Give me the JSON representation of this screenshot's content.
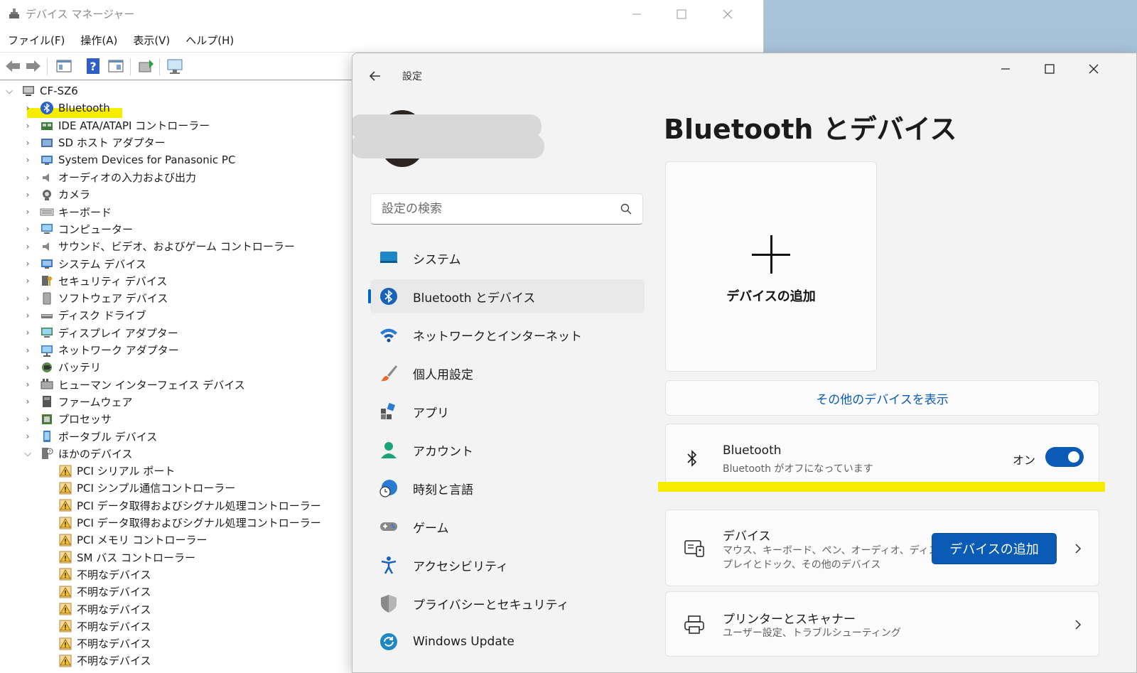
{
  "device_manager": {
    "title": "デバイス マネージャー",
    "menu": [
      "ファイル(F)",
      "操作(A)",
      "表示(V)",
      "ヘルプ(H)"
    ],
    "root": "CF-SZ6",
    "categories": [
      {
        "label": "Bluetooth",
        "icon": "bluetooth-icon"
      },
      {
        "label": "IDE ATA/ATAPI コントローラー",
        "icon": "ide-controller-icon"
      },
      {
        "label": "SD ホスト アダプター",
        "icon": "sd-host-icon"
      },
      {
        "label": "System Devices for Panasonic PC",
        "icon": "system-device-icon"
      },
      {
        "label": "オーディオの入力および出力",
        "icon": "speaker-icon"
      },
      {
        "label": "カメラ",
        "icon": "camera-icon"
      },
      {
        "label": "キーボード",
        "icon": "keyboard-icon"
      },
      {
        "label": "コンピューター",
        "icon": "computer-icon"
      },
      {
        "label": "サウンド、ビデオ、およびゲーム コントローラー",
        "icon": "speaker-icon"
      },
      {
        "label": "システム デバイス",
        "icon": "system-device-icon"
      },
      {
        "label": "セキュリティ デバイス",
        "icon": "security-device-icon"
      },
      {
        "label": "ソフトウェア デバイス",
        "icon": "software-device-icon"
      },
      {
        "label": "ディスク ドライブ",
        "icon": "disk-drive-icon"
      },
      {
        "label": "ディスプレイ アダプター",
        "icon": "display-adapter-icon"
      },
      {
        "label": "ネットワーク アダプター",
        "icon": "network-adapter-icon"
      },
      {
        "label": "バッテリ",
        "icon": "battery-icon"
      },
      {
        "label": "ヒューマン インターフェイス デバイス",
        "icon": "hid-icon"
      },
      {
        "label": "ファームウェア",
        "icon": "firmware-icon"
      },
      {
        "label": "プロセッサ",
        "icon": "processor-icon"
      },
      {
        "label": "ポータブル デバイス",
        "icon": "portable-device-icon"
      },
      {
        "label": "ほかのデバイス",
        "icon": "other-devices-icon"
      }
    ],
    "other_devices": [
      "PCI シリアル ポート",
      "PCI シンプル通信コントローラー",
      "PCI データ取得およびシグナル処理コントローラー",
      "PCI データ取得およびシグナル処理コントローラー",
      "PCI メモリ コントローラー",
      "SM バス コントローラー",
      "不明なデバイス",
      "不明なデバイス",
      "不明なデバイス",
      "不明なデバイス",
      "不明なデバイス",
      "不明なデバイス"
    ]
  },
  "settings": {
    "app_title": "設定",
    "search_placeholder": "設定の検索",
    "nav": [
      {
        "label": "システム",
        "icon": "system-icon",
        "active": false
      },
      {
        "label": "Bluetooth とデバイス",
        "icon": "bluetooth-icon",
        "active": true
      },
      {
        "label": "ネットワークとインターネット",
        "icon": "wifi-icon",
        "active": false
      },
      {
        "label": "個人用設定",
        "icon": "paintbrush-icon",
        "active": false
      },
      {
        "label": "アプリ",
        "icon": "apps-icon",
        "active": false
      },
      {
        "label": "アカウント",
        "icon": "account-icon",
        "active": false
      },
      {
        "label": "時刻と言語",
        "icon": "time-language-icon",
        "active": false
      },
      {
        "label": "ゲーム",
        "icon": "gamepad-icon",
        "active": false
      },
      {
        "label": "アクセシビリティ",
        "icon": "accessibility-icon",
        "active": false
      },
      {
        "label": "プライバシーとセキュリティ",
        "icon": "shield-icon",
        "active": false
      },
      {
        "label": "Windows Update",
        "icon": "windows-update-icon",
        "active": false
      }
    ],
    "page_title": "Bluetooth とデバイス",
    "add_device_tile": "デバイスの追加",
    "more_devices_link": "その他のデバイスを表示",
    "bluetooth": {
      "name": "Bluetooth",
      "status": "Bluetooth がオフになっています",
      "toggle_label": "オン",
      "toggle_on": true
    },
    "devices": {
      "title": "デバイス",
      "subtitle_line1": "マウス、キーボード、ペン、オーディオ、ディス",
      "subtitle_line2": "プレイとドック、その他のデバイス",
      "button": "デバイスの追加"
    },
    "printers": {
      "title": "プリンターとスキャナー",
      "subtitle": "ユーザー設定、トラブルシューティング"
    }
  },
  "colors": {
    "accent": "#0a5bb5",
    "highlight": "#f5ec00"
  }
}
